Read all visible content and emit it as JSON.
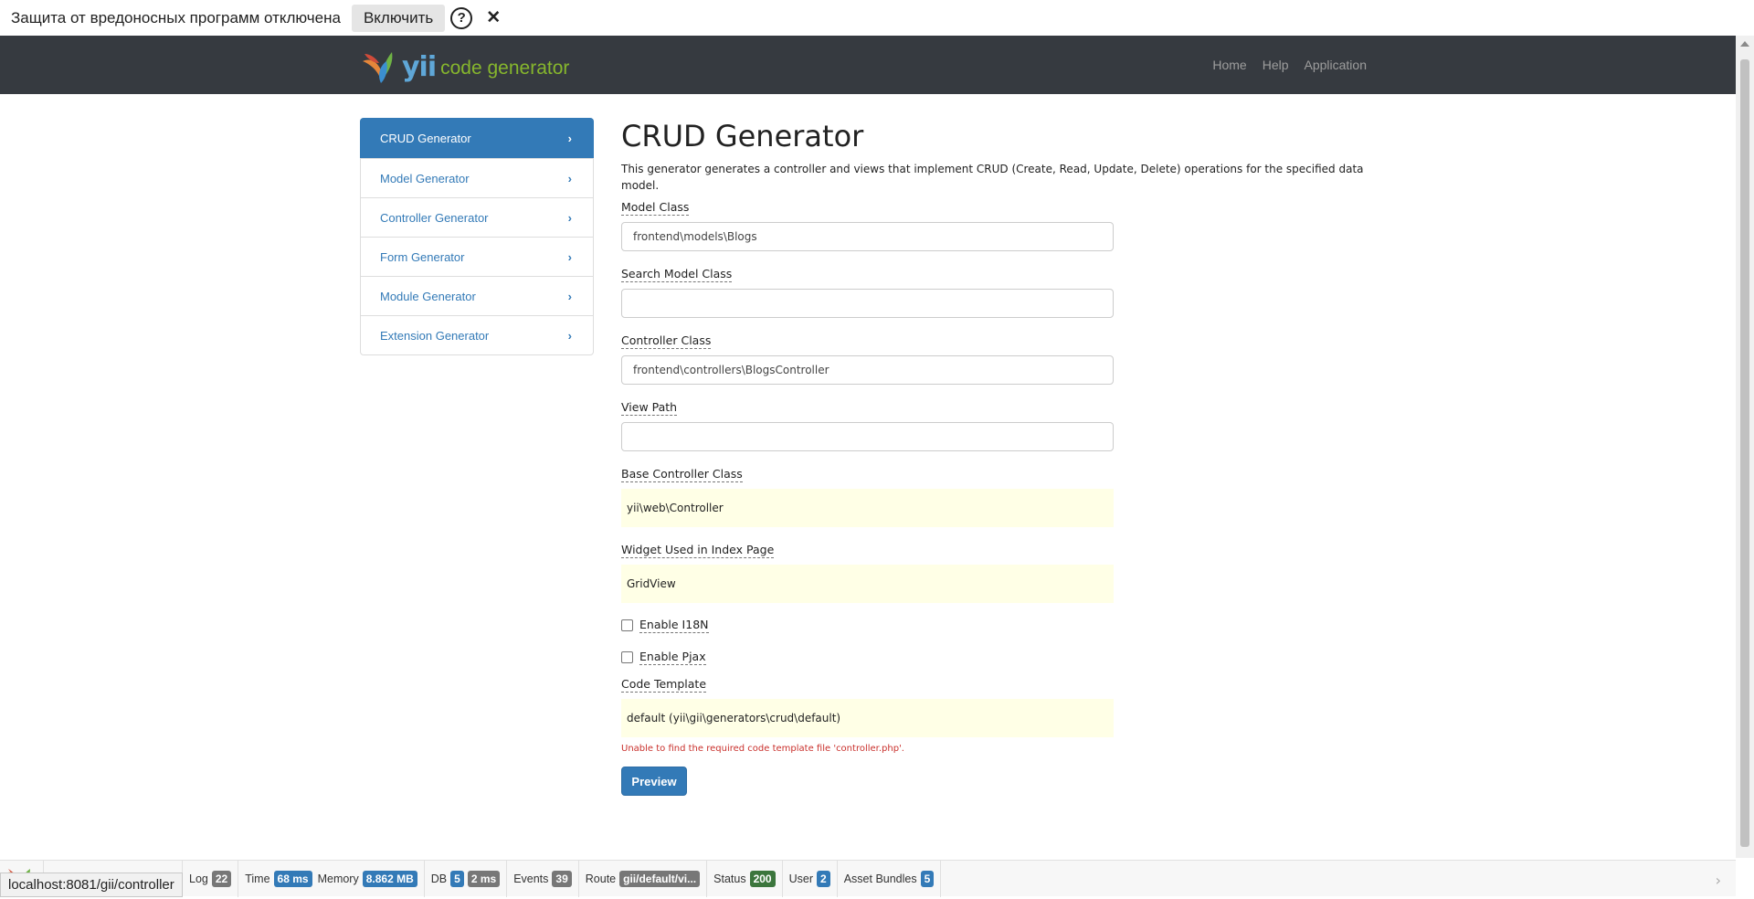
{
  "notification": {
    "text": "Защита от вредоносных программ отключена",
    "enable_label": "Включить",
    "help_glyph": "?",
    "close_glyph": "✕"
  },
  "navbar": {
    "brand_yii": "yii",
    "brand_rest": "code generator",
    "links": [
      "Home",
      "Help",
      "Application"
    ]
  },
  "sidebar": {
    "items": [
      {
        "label": "CRUD Generator",
        "active": true
      },
      {
        "label": "Model Generator",
        "active": false
      },
      {
        "label": "Controller Generator",
        "active": false
      },
      {
        "label": "Form Generator",
        "active": false
      },
      {
        "label": "Module Generator",
        "active": false
      },
      {
        "label": "Extension Generator",
        "active": false
      }
    ],
    "chevron": "›"
  },
  "main": {
    "title": "CRUD Generator",
    "description": "This generator generates a controller and views that implement CRUD (Create, Read, Update, Delete) operations for the specified data model.",
    "fields": {
      "model_class": {
        "label": "Model Class",
        "value": "frontend\\models\\Blogs"
      },
      "search_model_class": {
        "label": "Search Model Class",
        "value": ""
      },
      "controller_class": {
        "label": "Controller Class",
        "value": "frontend\\controllers\\BlogsController"
      },
      "view_path": {
        "label": "View Path",
        "value": ""
      },
      "base_controller_class": {
        "label": "Base Controller Class",
        "value": "yii\\web\\Controller"
      },
      "widget": {
        "label": "Widget Used in Index Page",
        "value": "GridView"
      },
      "code_template": {
        "label": "Code Template",
        "value": "default (yii\\gii\\generators\\crud\\default)"
      }
    },
    "checkboxes": {
      "enable_i18n": {
        "label": "Enable I18N",
        "checked": false
      },
      "enable_pjax": {
        "label": "Enable Pjax",
        "checked": false
      }
    },
    "error": "Unable to find the required code template file 'controller.php'.",
    "preview_label": "Preview"
  },
  "debug": {
    "log_label": "Log",
    "log_count": "22",
    "time_label": "Time",
    "time_value": "68 ms",
    "memory_label": "Memory",
    "memory_value": "8.862 MB",
    "db_label": "DB",
    "db_count": "5",
    "db_time": "2 ms",
    "events_label": "Events",
    "events_count": "39",
    "route_label": "Route",
    "route_value": "gii/default/vi...",
    "status_label": "Status",
    "status_value": "200",
    "user_label": "User",
    "user_value": "2",
    "bundles_label": "Asset Bundles",
    "bundles_count": "5",
    "collapse_glyph": "›"
  },
  "statusbar": {
    "url": "localhost:8081/gii/controller"
  },
  "colors": {
    "navbar": "#363a40",
    "primary": "#337ab7",
    "sticky": "#ffffe6",
    "error": "#c9302c",
    "status_green": "#3c763d"
  }
}
